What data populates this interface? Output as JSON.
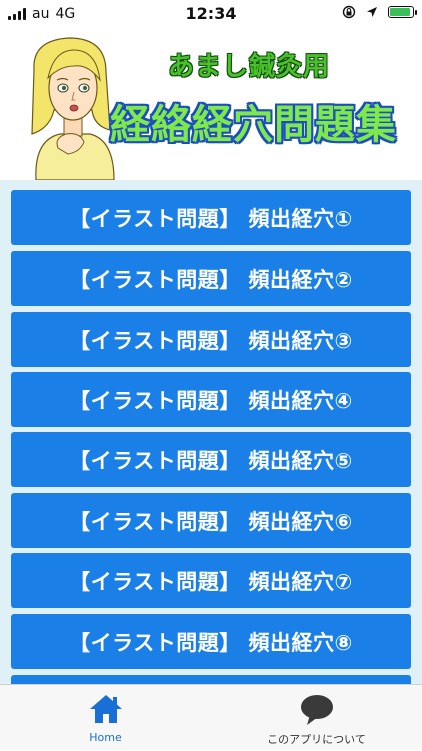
{
  "status_bar": {
    "carrier": "au",
    "network": "4G",
    "time": "12:34"
  },
  "header": {
    "subtitle": "あまし鍼灸用",
    "title": "経絡経穴問題集",
    "illustration": "girl-illustration"
  },
  "list": {
    "items": [
      {
        "label": "【イラスト問題】 頻出経穴①"
      },
      {
        "label": "【イラスト問題】 頻出経穴②"
      },
      {
        "label": "【イラスト問題】 頻出経穴③"
      },
      {
        "label": "【イラスト問題】 頻出経穴④"
      },
      {
        "label": "【イラスト問題】 頻出経穴⑤"
      },
      {
        "label": "【イラスト問題】 頻出経穴⑥"
      },
      {
        "label": "【イラスト問題】 頻出経穴⑦"
      },
      {
        "label": "【イラスト問題】 頻出経穴⑧"
      },
      {
        "label": ""
      }
    ]
  },
  "tab_bar": {
    "home_label": "Home",
    "about_label": "このアプリについて",
    "home_icon": "home-icon",
    "about_icon": "speech-bubble-icon"
  },
  "colors": {
    "button_blue": "#1a7fe6",
    "list_background": "#dff1f6",
    "title_green": "#7fe84a",
    "title_outline": "#1b4fc0",
    "subtitle_green": "#4bbf2a",
    "tab_active": "#1a6fd6"
  }
}
